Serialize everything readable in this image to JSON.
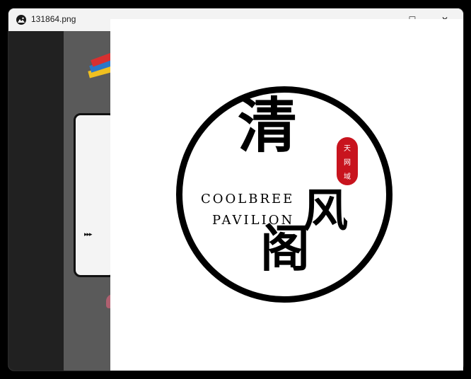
{
  "window": {
    "title": "131864.png",
    "minimize_glyph": "—",
    "maximize_glyph": "☐",
    "close_glyph": "✕"
  },
  "logo": {
    "char_top": "清",
    "char_right": "风",
    "char_bottom": "阁",
    "english_line1": "COOLBREE",
    "english_line2": "PAVILION",
    "seal": [
      "天",
      "网",
      "域"
    ]
  },
  "background": {
    "arrows": "▸▸▸"
  },
  "colors": {
    "seal_red": "#c8141e",
    "titlebar": "#f3f3f3",
    "viewer": "#ffffff"
  }
}
